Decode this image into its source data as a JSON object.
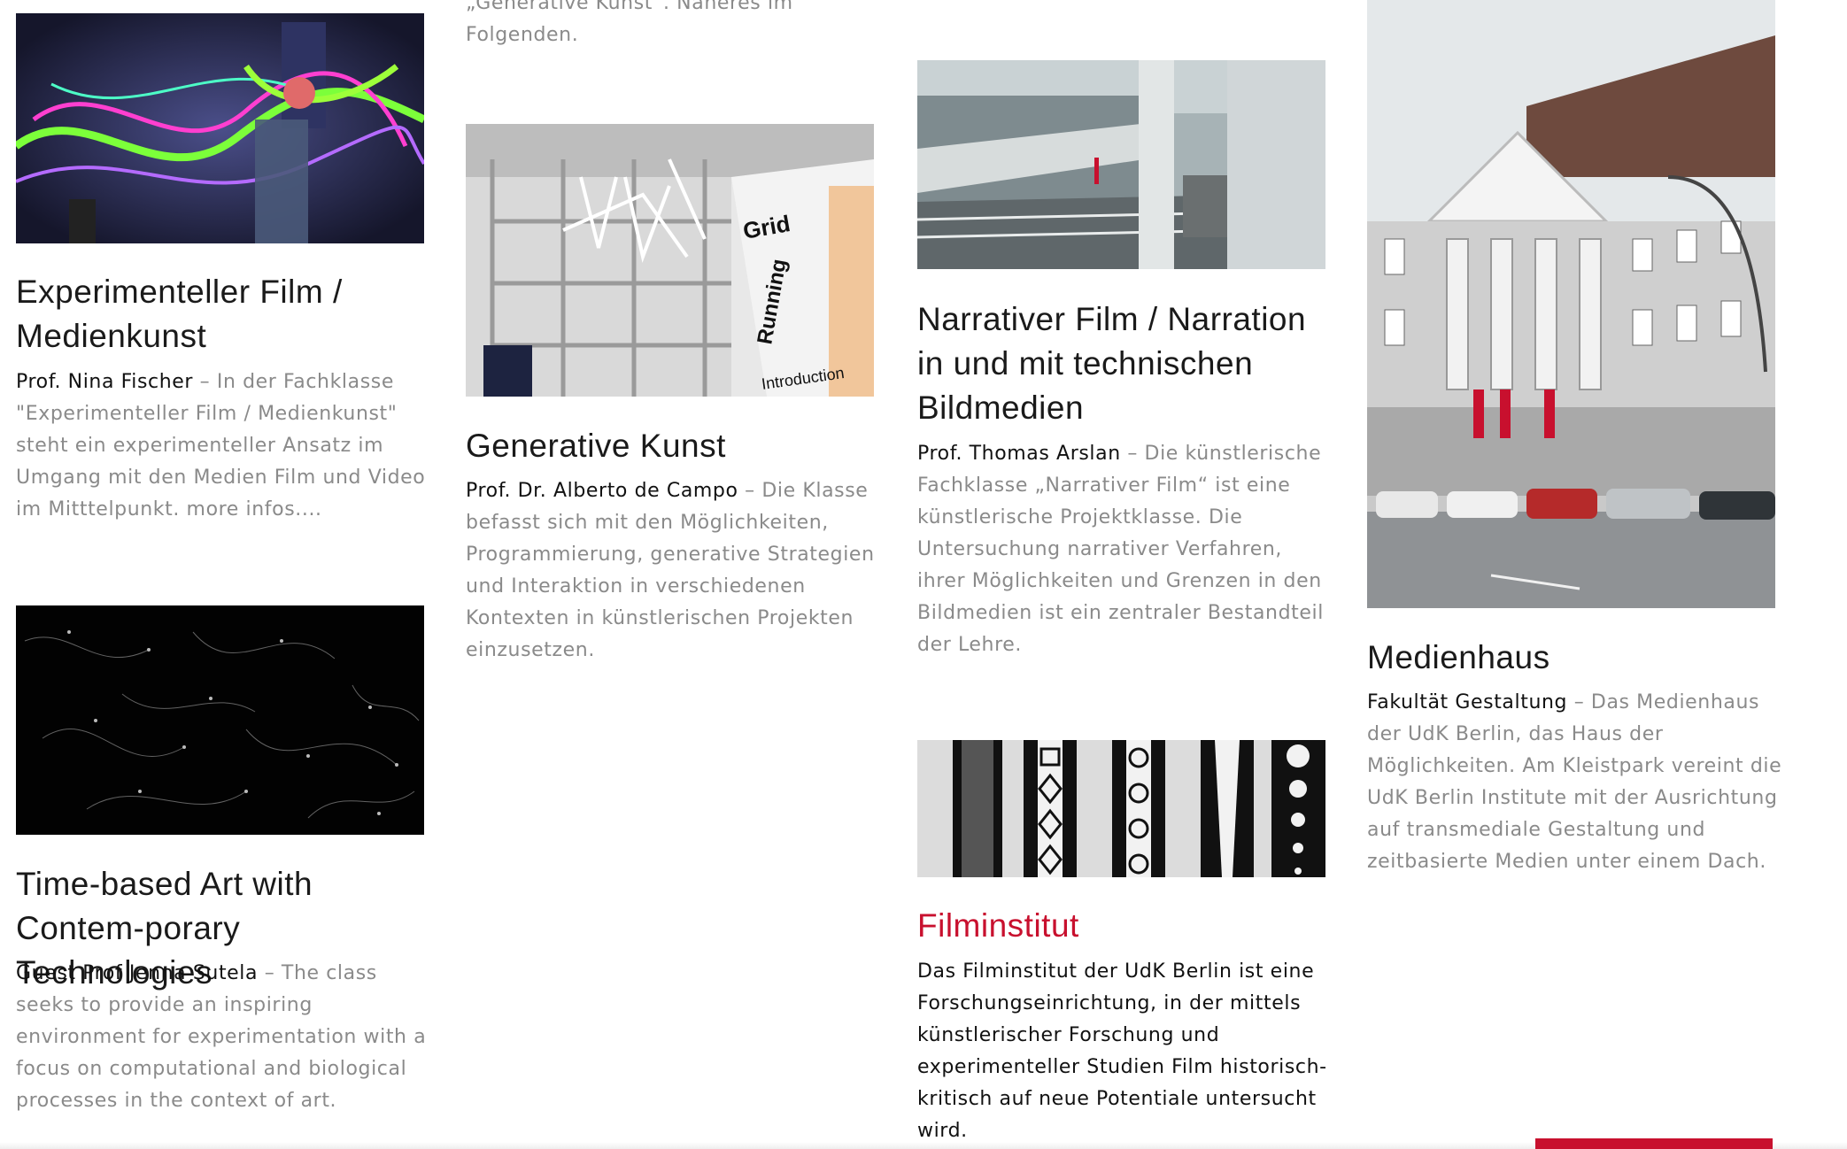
{
  "cards": [
    {
      "id": "exp-film",
      "title": "Experimenteller Film / Medienkunst",
      "person": "Prof. Nina Fischer",
      "text": "In der Fachklasse \"Experimenteller Film / Medienkunst\" steht ein experimenteller Ansatz im Umgang mit den Medien Film und Video im Mitttelpunkt. more infos...."
    },
    {
      "id": "time-based",
      "title": "Time-based Art with Contem-porary Technologies",
      "person": "Guest Prof Jenna Sutela",
      "text": "The class seeks to provide an inspiring environment for experimentation with a focus on computational and biological processes in the context of art."
    },
    {
      "id": "generative",
      "title": "Generative Kunst",
      "person": "Prof. Dr. Alberto de Campo",
      "text": "Die Klasse befasst sich mit den Möglichkeiten, Programmierung, generative Strategien und Interaktion in verschiedenen Kontexten in künstlerischen Projekten einzusetzen."
    },
    {
      "id": "narrativ",
      "title": "Narrativer Film / Narration in und mit technischen Bildmedien",
      "person": "Prof. Thomas Arslan",
      "text": "Die künstlerische Fachklasse „Narrativer Film“ ist eine künstlerische Projektklasse. Die Untersuchung narrativer Verfahren, ihrer Möglichkeiten und Grenzen in den Bildmedien ist ein zentraler Bestandteil der Lehre."
    },
    {
      "id": "filminstitut",
      "title": "Filminstitut",
      "text": "Das Filminstitut der UdK Berlin ist eine Forschungseinrichtung, in der mittels künstlerischer Forschung und experimenteller Studien Film historisch-kritisch auf neue Potentiale untersucht wird."
    },
    {
      "id": "medienhaus",
      "title": "Medienhaus",
      "person": "Fakultät Gestaltung",
      "text": "Das Medienhaus der UdK Berlin, das Haus der Möglichkeiten. Am Kleistpark vereint die UdK Berlin Institute mit der Ausrichtung auf transmediale Gestaltung und zeitbasierte Medien unter einem Dach."
    }
  ],
  "cut_text": "„Generative Kunst“. Näheres im Folgenden.",
  "separator": " – ",
  "image_texts": {
    "banner_line1": "Grid",
    "banner_line2": "Running",
    "banner_line3": "Introduction"
  },
  "colors": {
    "accent": "#c8102e",
    "muted": "#8a8a8a",
    "text": "#111111"
  }
}
